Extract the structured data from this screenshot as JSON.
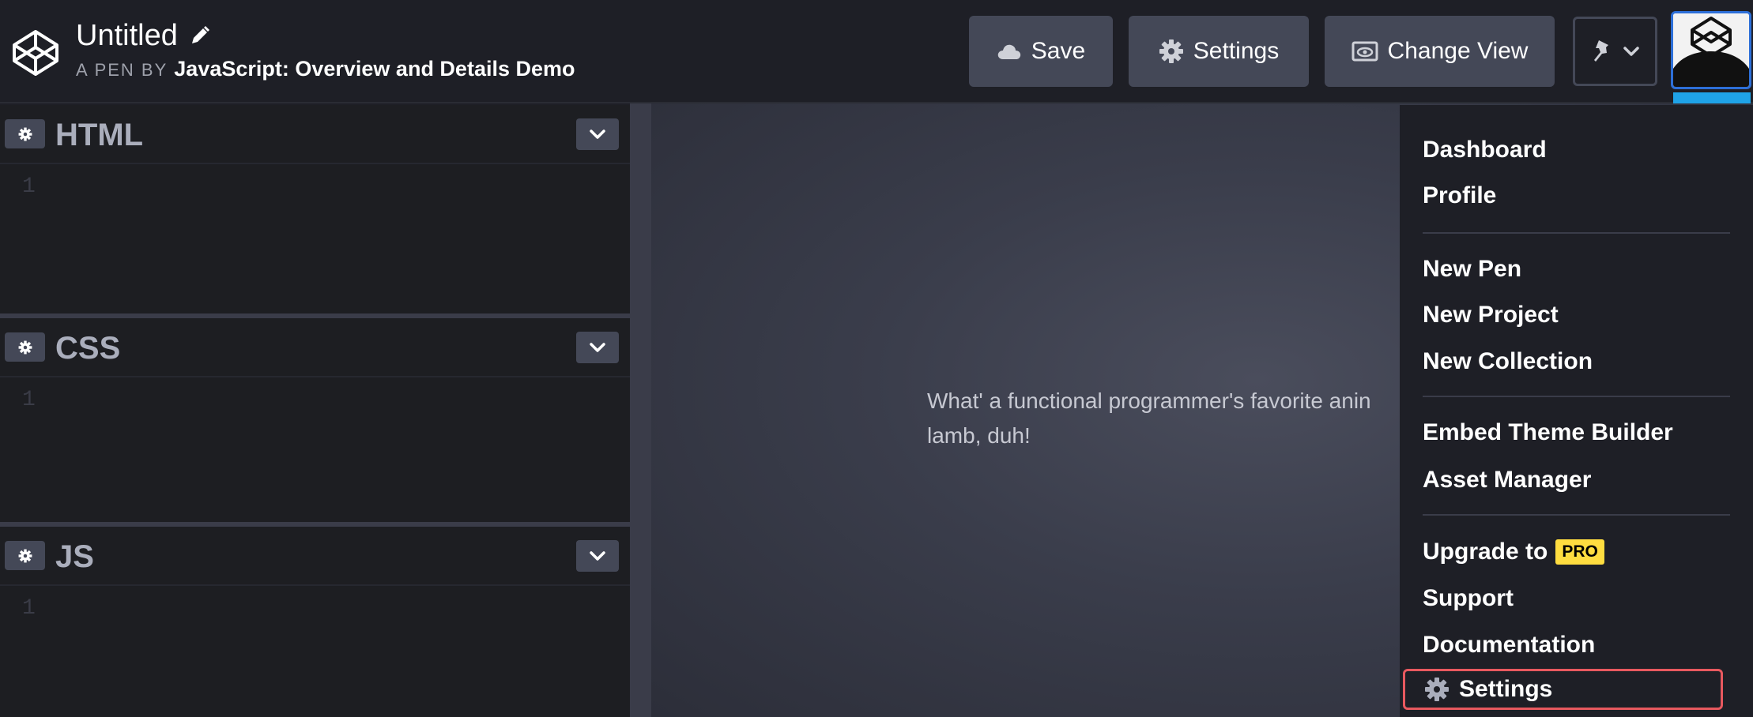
{
  "header": {
    "title": "Untitled",
    "by_prefix": "A PEN BY",
    "author": "JavaScript: Overview and Details Demo",
    "save_label": "Save",
    "settings_label": "Settings",
    "change_view_label": "Change View"
  },
  "editors": [
    {
      "name": "HTML",
      "line_number": "1"
    },
    {
      "name": "CSS",
      "line_number": "1"
    },
    {
      "name": "JS",
      "line_number": "1"
    }
  ],
  "preview": {
    "line1": "What' a functional programmer's favorite anin",
    "line2": "lamb, duh!"
  },
  "menu": {
    "dashboard": "Dashboard",
    "profile": "Profile",
    "new_pen": "New Pen",
    "new_project": "New Project",
    "new_collection": "New Collection",
    "embed_theme_builder": "Embed Theme Builder",
    "asset_manager": "Asset Manager",
    "upgrade_to": "Upgrade to",
    "pro_badge": "PRO",
    "support": "Support",
    "documentation": "Documentation",
    "settings": "Settings"
  },
  "colors": {
    "background": "#1e1f26",
    "button": "#444857",
    "pro_badge": "#ffdd40",
    "highlight_outline": "#e8595f",
    "avatar_accent": "#1fa3e8"
  },
  "icons": [
    "codepen-logo-icon",
    "pencil-icon",
    "cloud-icon",
    "gear-icon",
    "eye-icon",
    "pin-icon",
    "chevron-down-icon"
  ]
}
